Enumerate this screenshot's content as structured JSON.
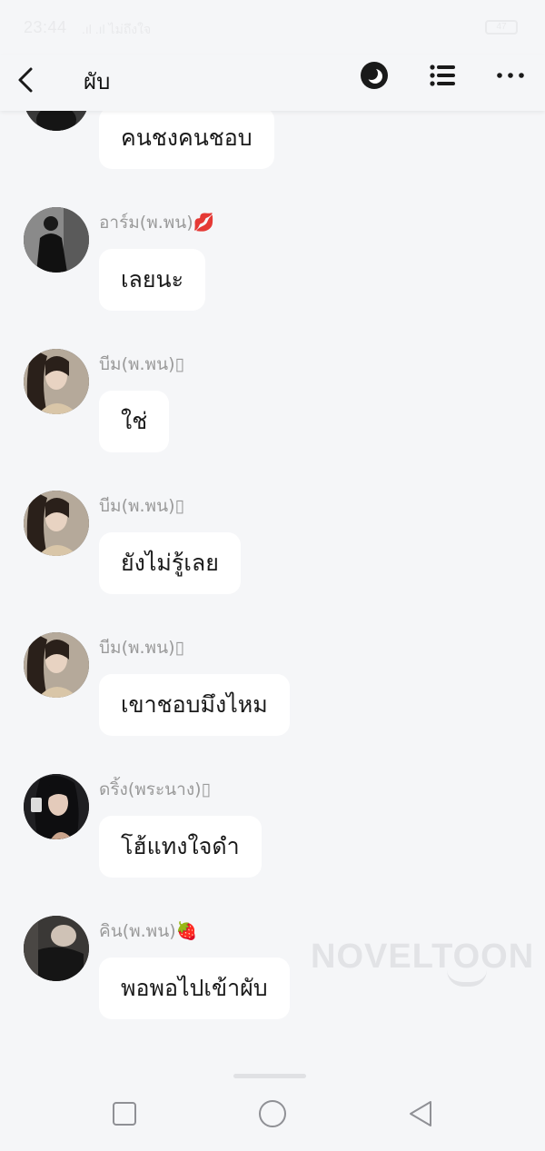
{
  "status_bar": {
    "time": "23:44",
    "network": ".ıl .ıl ไม่ถึงใจ",
    "battery": "47"
  },
  "header": {
    "title": "ผับ",
    "back_icon": "chevron-left-icon",
    "mode_icon": "moon-circle-icon",
    "list_icon": "list-icon",
    "more_icon": "more-horizontal-icon"
  },
  "messages": [
    {
      "sender": "",
      "text": "คนชงคนชอบ"
    },
    {
      "sender": "อาร์ม(พ.พน)💋",
      "text": "เลยนะ"
    },
    {
      "sender": "บีม(พ.พน)▯",
      "text": "ใช่"
    },
    {
      "sender": "บีม(พ.พน)▯",
      "text": "ยังไม่รู้เลย"
    },
    {
      "sender": "บีม(พ.พน)▯",
      "text": "เขาชอบมึงไหม"
    },
    {
      "sender": "ดริ้ง(พระนาง)▯",
      "text": "โฮ้แทงใจดำ"
    },
    {
      "sender": "คิน(พ.พน)🍓",
      "text": "พอพอไปเข้าผับ"
    }
  ],
  "watermark": "NOVELTOON",
  "navbar": {
    "recent_icon": "square-icon",
    "home_icon": "circle-icon",
    "back_icon": "triangle-back-icon"
  },
  "colors": {
    "background": "#f5f6f8",
    "bubble": "#ffffff",
    "sender_text": "#9a9a9a"
  }
}
